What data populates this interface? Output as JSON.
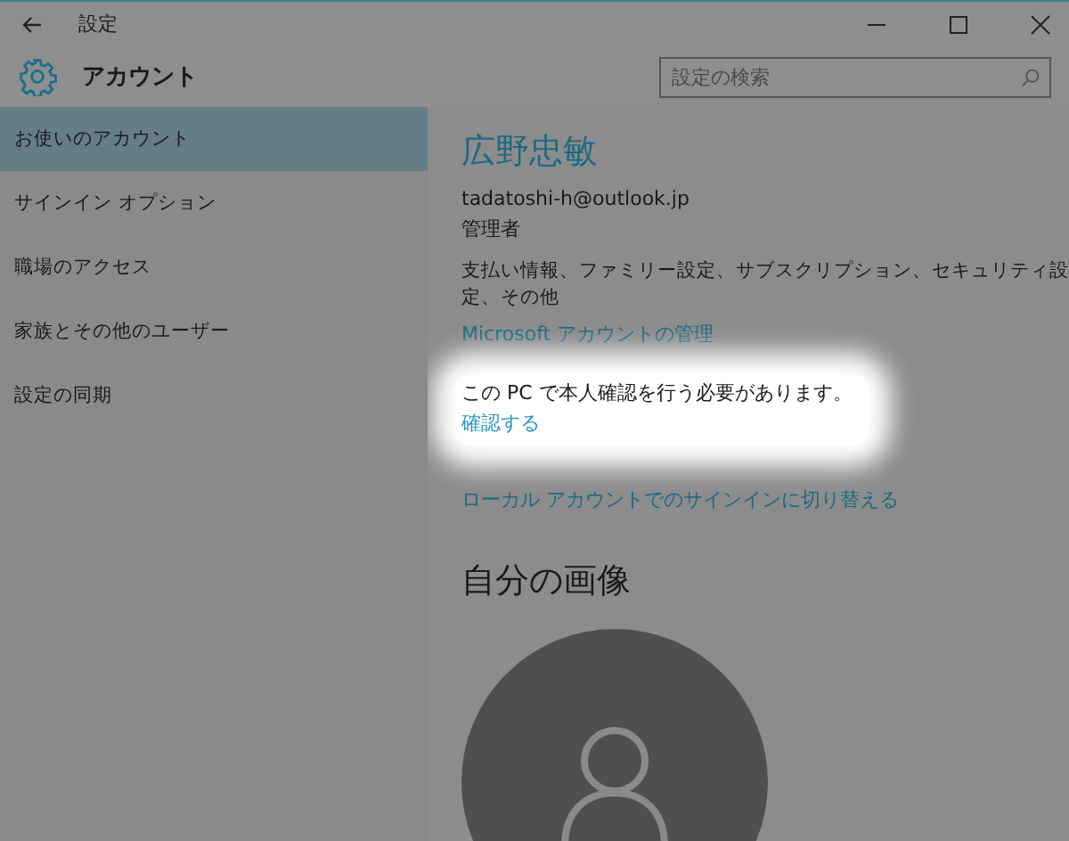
{
  "window": {
    "title": "設定"
  },
  "header": {
    "title": "アカウント",
    "search": {
      "placeholder": "設定の検索"
    }
  },
  "sidebar": {
    "items": [
      {
        "label": "お使いのアカウント",
        "selected": true
      },
      {
        "label": "サインイン オプション",
        "selected": false
      },
      {
        "label": "職場のアクセス",
        "selected": false
      },
      {
        "label": "家族とその他のユーザー",
        "selected": false
      },
      {
        "label": "設定の同期",
        "selected": false
      }
    ]
  },
  "account": {
    "name": "広野忠敏",
    "email": "tadatoshi-h@outlook.jp",
    "role": "管理者",
    "description": "支払い情報、ファミリー設定、サブスクリプション、セキュリティ設定、その他",
    "manage_link": "Microsoft アカウントの管理"
  },
  "verify": {
    "message": "この PC で本人確認を行う必要があります。",
    "link": "確認する"
  },
  "switch_link": "ローカル アカウントでのサインインに切り替える",
  "picture": {
    "heading": "自分の画像"
  }
}
